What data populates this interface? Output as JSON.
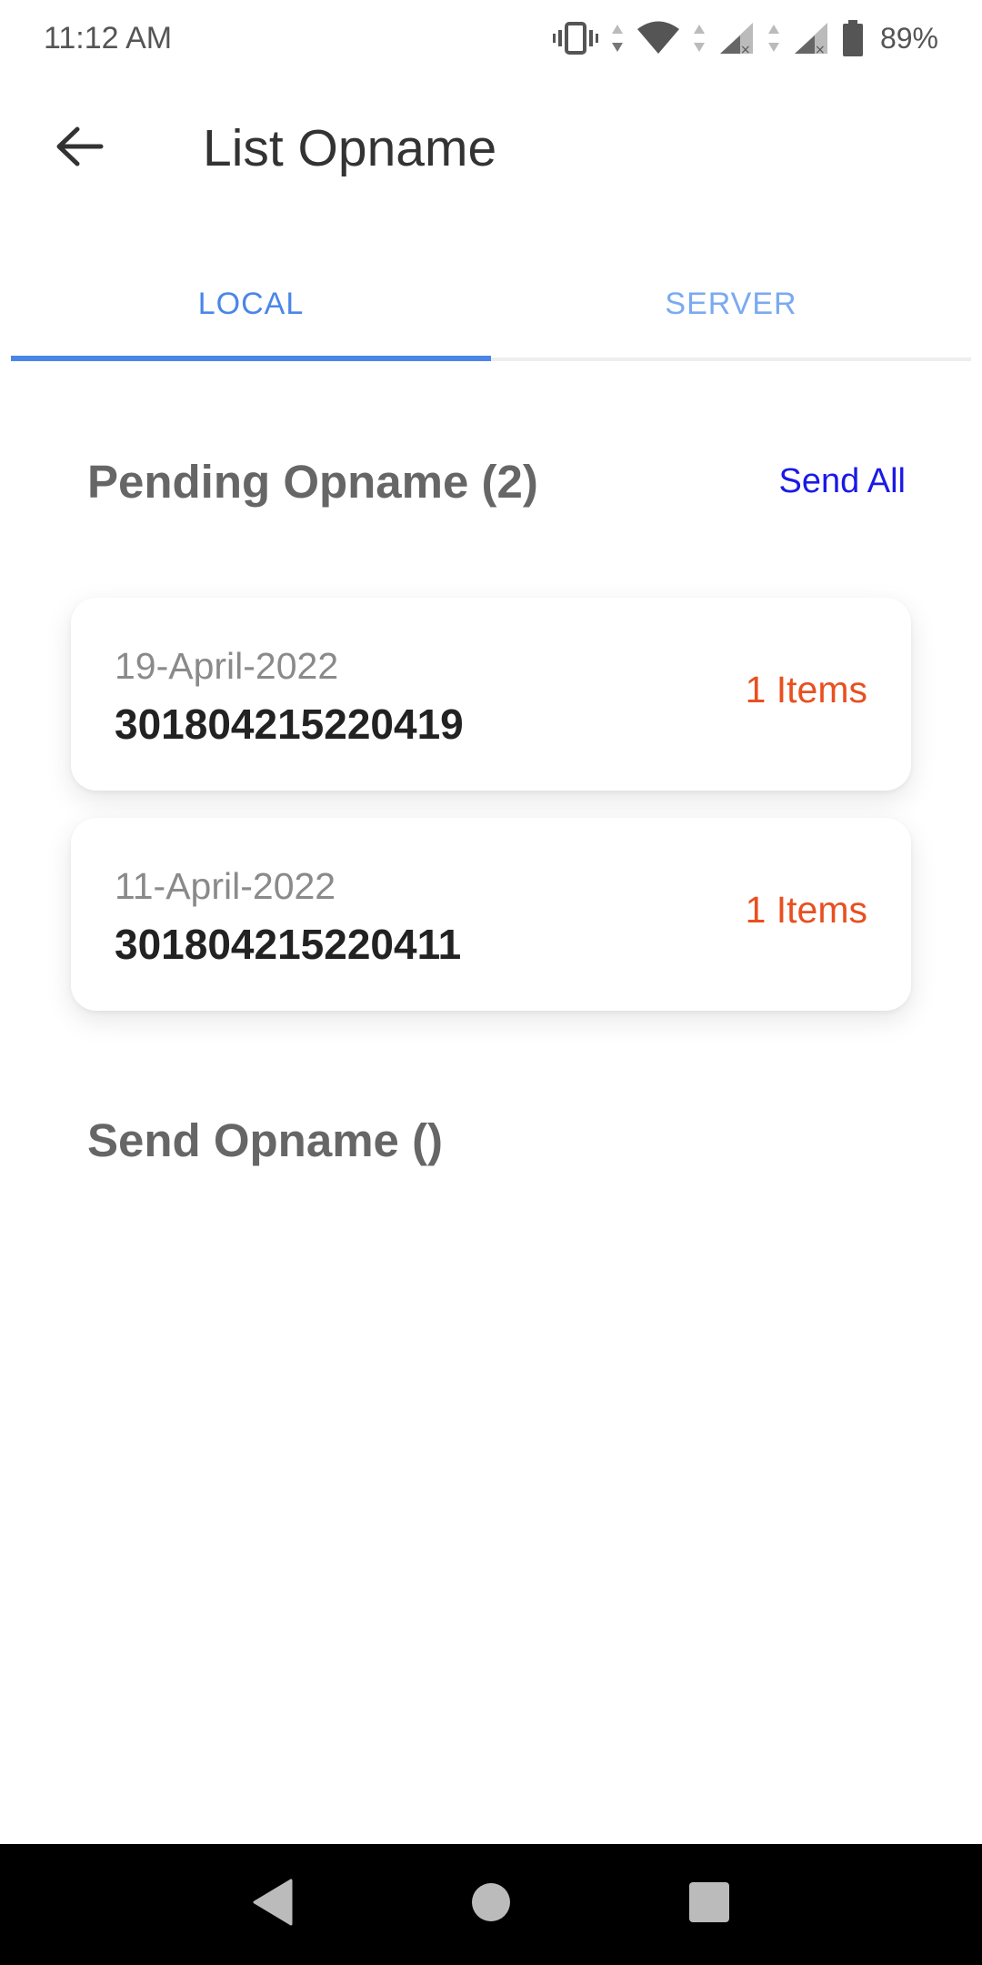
{
  "status_bar": {
    "time": "11:12 AM",
    "battery": "89%",
    "icons": [
      "vibrate-icon",
      "wifi-icon",
      "signal-icon",
      "signal-icon",
      "battery-icon"
    ]
  },
  "app_bar": {
    "title": "List Opname",
    "back_icon": "arrow-back-icon"
  },
  "tabs": [
    {
      "label": "LOCAL",
      "active": true
    },
    {
      "label": "SERVER",
      "active": false
    }
  ],
  "pending": {
    "title": "Pending Opname (2)",
    "action_label": "Send All",
    "items": [
      {
        "date": "19-April-2022",
        "code": "301804215220419",
        "items": "1 Items"
      },
      {
        "date": "11-April-2022",
        "code": "301804215220411",
        "items": "1 Items"
      }
    ]
  },
  "sent": {
    "title": "Send Opname ()"
  },
  "nav_bar": {
    "buttons": [
      "back-triangle-icon",
      "home-circle-icon",
      "recents-square-icon"
    ]
  },
  "colors": {
    "accent": "#4a86e8",
    "items_count": "#e8501f",
    "send_all": "#1a1ae6"
  }
}
